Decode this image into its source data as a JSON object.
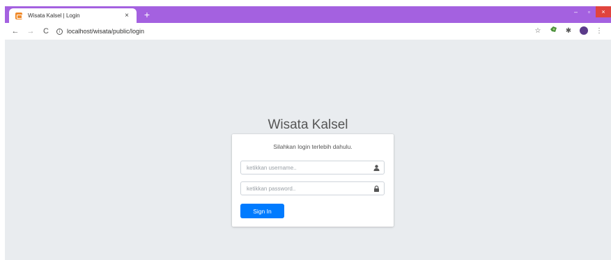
{
  "browser": {
    "tab": {
      "title": "Wisata Kalsel | Login",
      "favicon": "tab-favicon-icon",
      "close_glyph": "×"
    },
    "new_tab_glyph": "+",
    "window_controls": {
      "minimize": "–",
      "maximize": "▫",
      "close": "×"
    },
    "nav": {
      "back": "←",
      "forward": "→",
      "reload": "C"
    },
    "address": {
      "info_glyph": "i",
      "url": "localhost/wisata/public/login"
    },
    "toolbar_icons": [
      "star-icon",
      "extension-icon",
      "puzzle-icon",
      "profile-avatar",
      "menu-icon"
    ],
    "star_glyph": "☆",
    "puzzle_glyph": "✱",
    "menu_glyph": "⋮"
  },
  "colors": {
    "tabstrip": "#a461e0",
    "page_bg": "#e9ecef",
    "primary": "#007bff"
  },
  "login": {
    "brand": "Wisata Kalsel",
    "message": "Silahkan login terlebih dahulu.",
    "username_placeholder": "ketikkan username..",
    "password_placeholder": "ketikkan password..",
    "signin_label": "Sign In"
  }
}
